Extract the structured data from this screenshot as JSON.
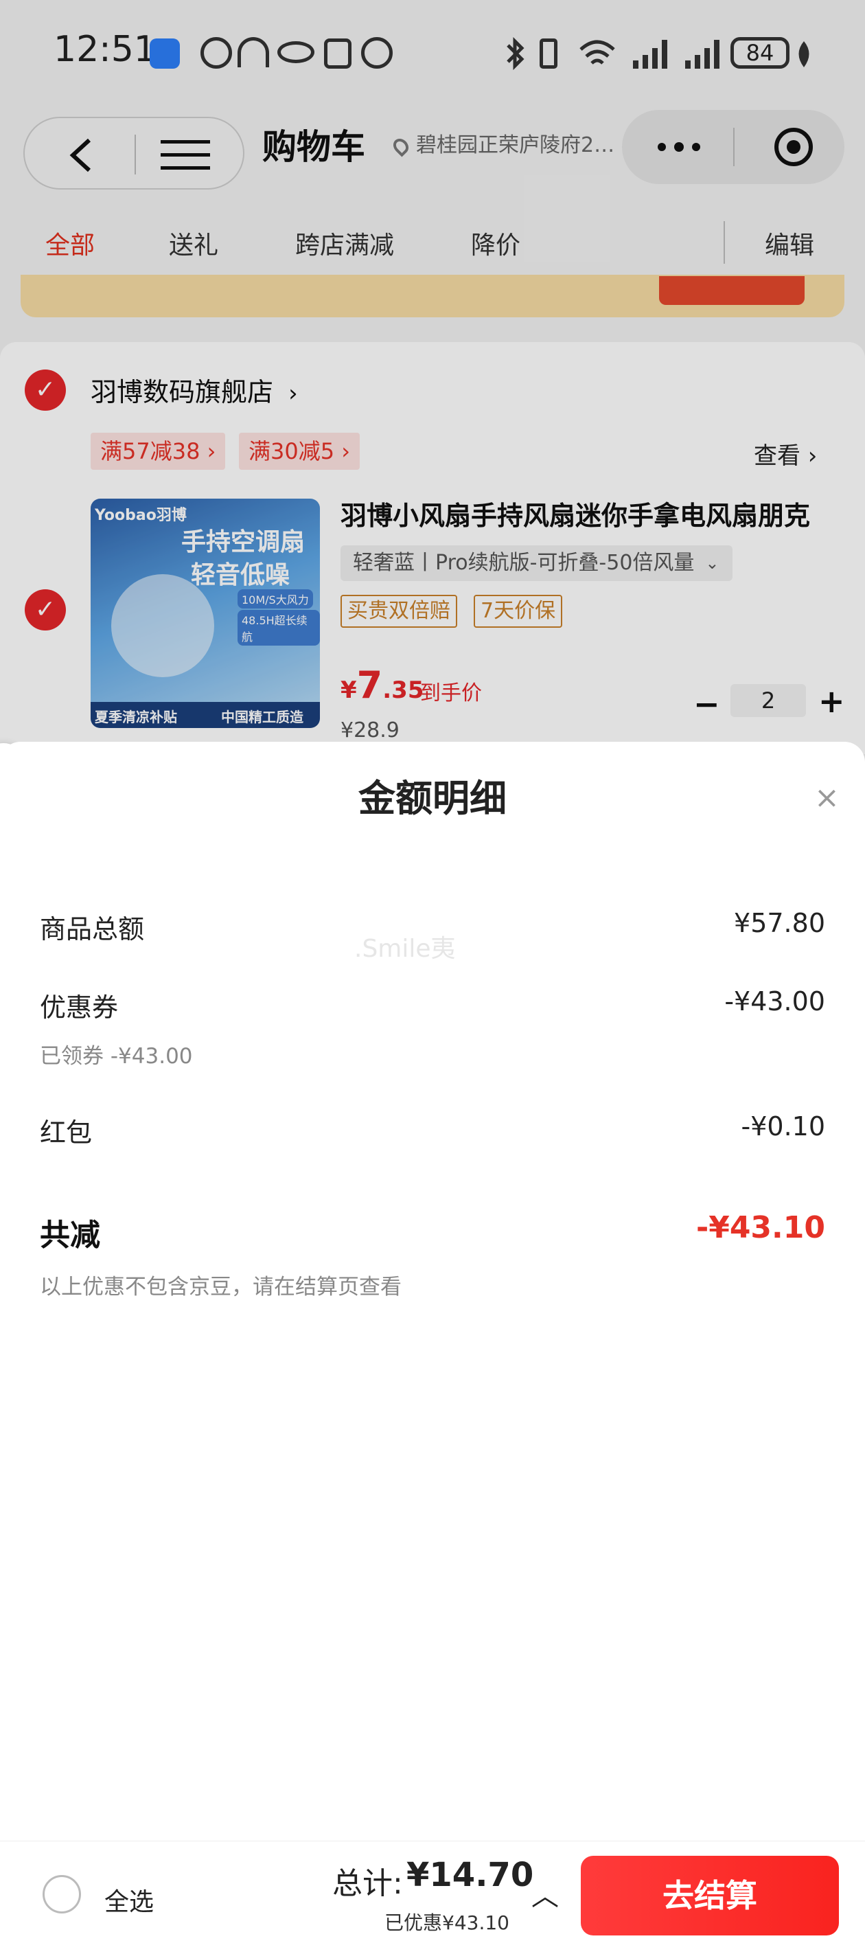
{
  "status_bar": {
    "time": "12:51",
    "battery": "84",
    "icons": [
      "app-badge-icon",
      "nfc-off-icon",
      "headphones-icon",
      "eye-icon",
      "nfc-icon",
      "alarm-icon",
      "bluetooth-icon",
      "vibrate-icon",
      "wifi-icon",
      "signal-icon",
      "signal-icon-2",
      "battery-icon",
      "leaf-icon"
    ]
  },
  "header": {
    "title": "购物车",
    "location": "碧桂园正荣庐陵府2…"
  },
  "tabs": [
    {
      "label": "全部",
      "active": true
    },
    {
      "label": "送礼"
    },
    {
      "label": "跨店满减"
    },
    {
      "label": "降价"
    }
  ],
  "edit_label": "编辑",
  "store": {
    "name": "羽博数码旗舰店",
    "chevron": "›",
    "coupons": [
      "满57减38 ›",
      "满30减5 ›"
    ],
    "view_label": "查看 ›"
  },
  "product": {
    "title": "羽博小风扇手持风扇迷你手拿电风扇朋克",
    "spec": "轻奢蓝丨Pro续航版-可折叠-50倍风量",
    "service_tags": [
      "买贵双倍赔",
      "7天价保"
    ],
    "price_symbol": "¥",
    "price_int": "7",
    "price_dec": ".35",
    "price_label": "到手价",
    "old_price": "¥28.9",
    "quantity": "2",
    "image_text": {
      "brand": "Yoobao羽博",
      "headline1": "手持空调扇",
      "headline2": "轻音低噪",
      "badge1": "10M/S大风力",
      "badge2": "48.5H超长续航",
      "footer_left": "夏季清凉补贴",
      "footer_right": "中国精工质造"
    }
  },
  "sheet": {
    "title": "金额明细",
    "close": "×",
    "watermark": ".Smile夷",
    "rows": [
      {
        "label": "商品总额",
        "value": "¥57.80"
      },
      {
        "label": "优惠券",
        "value": "-¥43.00",
        "sub": "已领券 -¥43.00"
      },
      {
        "label": "红包",
        "value": "-¥0.10"
      }
    ],
    "total_label": "共减",
    "total_value": "-¥43.10",
    "note": "以上优惠不包含京豆，请在结算页查看"
  },
  "footer": {
    "select_all": "全选",
    "sum_label": "总计:",
    "sum_value": "¥14.70",
    "saved": "已优惠¥43.10",
    "caret": "︿",
    "checkout": "去结算"
  },
  "colors": {
    "accent": "#e53227",
    "checkout_start": "#ff3b3b",
    "checkout_end": "#f9231f",
    "promo": "#f6dca4",
    "service_tag": "#c9802a"
  }
}
